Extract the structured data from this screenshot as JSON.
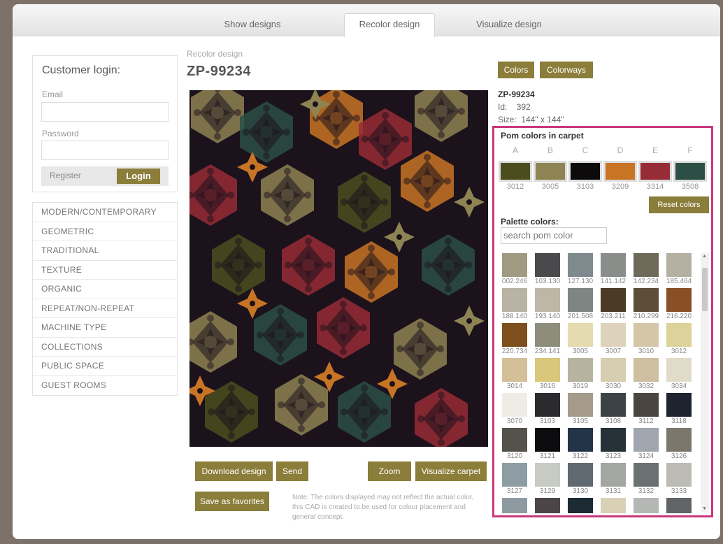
{
  "tabs": [
    {
      "label": "Show designs",
      "active": false
    },
    {
      "label": "Recolor design",
      "active": true
    },
    {
      "label": "Visualize design",
      "active": false
    }
  ],
  "login": {
    "title": "Customer login:",
    "email_label": "Email",
    "email_value": "",
    "password_label": "Password",
    "password_value": "",
    "register_label": "Register",
    "login_label": "Login"
  },
  "categories": [
    "MODERN/CONTEMPORARY",
    "GEOMETRIC",
    "TRADITIONAL",
    "TEXTURE",
    "ORGANIC",
    "REPEAT/NON-REPEAT",
    "MACHINE TYPE",
    "COLLECTIONS",
    "PUBLIC SPACE",
    "GUEST ROOMS"
  ],
  "main": {
    "breadcrumb": "Recolor design",
    "title": "ZP-99234",
    "buttons": {
      "download": "Download design",
      "send": "Send",
      "zoom": "Zoom",
      "visualize": "Visualize carpet",
      "favorites": "Save as favorites"
    },
    "note": "Note: The colors displayed may not reflect the actual color, this CAD is created to be used for colour placement and general concept."
  },
  "right": {
    "colors_btn": "Colors",
    "colorways_btn": "Colorways",
    "design_name": "ZP-99234",
    "id_label": "Id:",
    "id_value": "392",
    "size_label": "Size:",
    "size_value": "144\" x 144\"",
    "pom_heading": "Pom colors in carpet",
    "poms": [
      {
        "letter": "A",
        "code": "3012",
        "color": "#4b4d1f"
      },
      {
        "letter": "B",
        "code": "3005",
        "color": "#8e8352"
      },
      {
        "letter": "C",
        "code": "3103",
        "color": "#0d0a0b"
      },
      {
        "letter": "D",
        "code": "3209",
        "color": "#c87425"
      },
      {
        "letter": "E",
        "code": "3314",
        "color": "#962c35"
      },
      {
        "letter": "F",
        "code": "3508",
        "color": "#2b4f45"
      }
    ],
    "reset_btn": "Reset colors",
    "palette_heading": "Palette colors:",
    "search_placeholder": "search pom color",
    "palette": [
      {
        "code": "002.246",
        "color": "#a09a80"
      },
      {
        "code": "103.130",
        "color": "#4a4a4c"
      },
      {
        "code": "127.130",
        "color": "#7f8a8e"
      },
      {
        "code": "141.142",
        "color": "#8a8e8a"
      },
      {
        "code": "142.234",
        "color": "#6e6a5a"
      },
      {
        "code": "185.464",
        "color": "#b4b0a2"
      },
      {
        "code": "188.140",
        "color": "#b8b3a2"
      },
      {
        "code": "193.140",
        "color": "#bfb7a6"
      },
      {
        "code": "201.508",
        "color": "#7e8583"
      },
      {
        "code": "203.211",
        "color": "#4a3a26"
      },
      {
        "code": "210.299",
        "color": "#5d4e3a"
      },
      {
        "code": "216.220",
        "color": "#8a4f24"
      },
      {
        "code": "220.734",
        "color": "#7e4f1c"
      },
      {
        "code": "234.141",
        "color": "#8e8d7c"
      },
      {
        "code": "3005",
        "color": "#e4dcb0"
      },
      {
        "code": "3007",
        "color": "#ddd3bd"
      },
      {
        "code": "3010",
        "color": "#d5c6a8"
      },
      {
        "code": "3012",
        "color": "#dcd29a"
      },
      {
        "code": "3014",
        "color": "#d4bf99"
      },
      {
        "code": "3016",
        "color": "#d9c87c"
      },
      {
        "code": "3019",
        "color": "#b6b4a0"
      },
      {
        "code": "3030",
        "color": "#d7cdb1"
      },
      {
        "code": "3032",
        "color": "#cdbf9f"
      },
      {
        "code": "3034",
        "color": "#e1dcc9"
      },
      {
        "code": "3070",
        "color": "#efece6"
      },
      {
        "code": "3103",
        "color": "#2b2b2d"
      },
      {
        "code": "3105",
        "color": "#a49b8a"
      },
      {
        "code": "3108",
        "color": "#3c4347"
      },
      {
        "code": "3112",
        "color": "#4a4540"
      },
      {
        "code": "3118",
        "color": "#1e2330"
      },
      {
        "code": "3120",
        "color": "#55524b"
      },
      {
        "code": "3121",
        "color": "#0c0c0e"
      },
      {
        "code": "3122",
        "color": "#243448"
      },
      {
        "code": "3123",
        "color": "#263238"
      },
      {
        "code": "3124",
        "color": "#a0a6ae"
      },
      {
        "code": "3126",
        "color": "#7c776c"
      },
      {
        "code": "3127",
        "color": "#8c9da3"
      },
      {
        "code": "3129",
        "color": "#c7cbc3"
      },
      {
        "code": "3130",
        "color": "#606a70"
      },
      {
        "code": "3131",
        "color": "#a4a6a1"
      },
      {
        "code": "3132",
        "color": "#6b7170"
      },
      {
        "code": "3133",
        "color": "#bcbcb4"
      },
      {
        "code": "",
        "color": "#8e9aa2"
      },
      {
        "code": "",
        "color": "#4c4547"
      },
      {
        "code": "",
        "color": "#1c2a34"
      },
      {
        "code": "",
        "color": "#d9d0b8"
      },
      {
        "code": "",
        "color": "#b5b7b4"
      },
      {
        "code": "",
        "color": "#606466"
      }
    ]
  },
  "colors": {
    "accent": "#8b7d3a",
    "highlight_border": "#c9377b",
    "background": "#7d7269"
  }
}
